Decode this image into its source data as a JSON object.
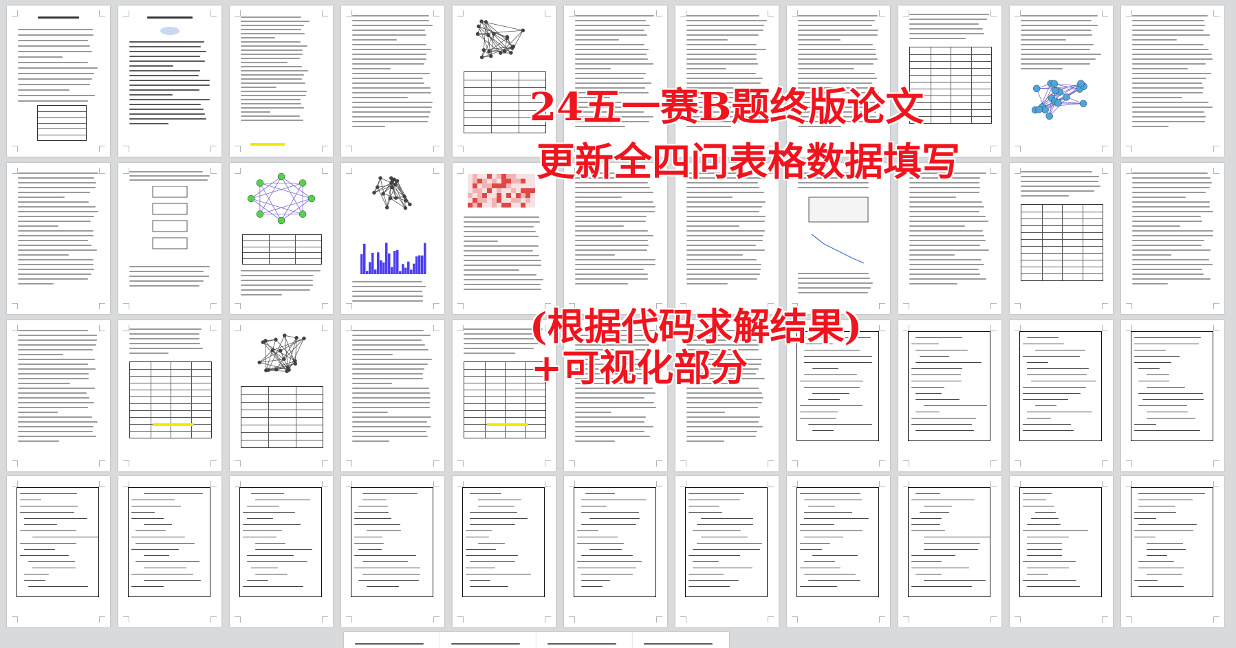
{
  "overlay": {
    "line1": "24五一赛B题终版论文",
    "line2": "更新全四问表格数据填写",
    "line3": "(根据代码求解结果)",
    "line4": "+可视化部分"
  },
  "colors": {
    "background": "#d9dadc",
    "page": "#ffffff",
    "overlay_text": "#f0141e",
    "highlight": "#f3e900",
    "network_node_green": "#56d24e",
    "network_node_blue": "#4aa6dc",
    "histogram_bar": "#4b3ef2"
  },
  "thumbnails": {
    "rows": 4,
    "columns": 11,
    "extra_bottom_pages": 4,
    "page_kinds": [
      [
        "cover",
        "title",
        "toc",
        "text",
        "graph",
        "text",
        "text",
        "text",
        "table",
        "network-blue",
        "text"
      ],
      [
        "text",
        "flowchart",
        "network-green",
        "graph-hist",
        "heatmap",
        "text",
        "text",
        "diagram-plot",
        "text",
        "table",
        "text"
      ],
      [
        "text",
        "table",
        "graph",
        "text",
        "table",
        "text",
        "text",
        "code",
        "code",
        "code",
        "code"
      ],
      [
        "code",
        "code",
        "code",
        "code",
        "code",
        "code",
        "code",
        "code",
        "code",
        "code",
        "code"
      ]
    ]
  },
  "cover": {
    "title": "五一数学建模竞赛",
    "subtitle": "承 诺 书"
  },
  "title_page": {
    "title": "五一数学建模竞赛"
  }
}
